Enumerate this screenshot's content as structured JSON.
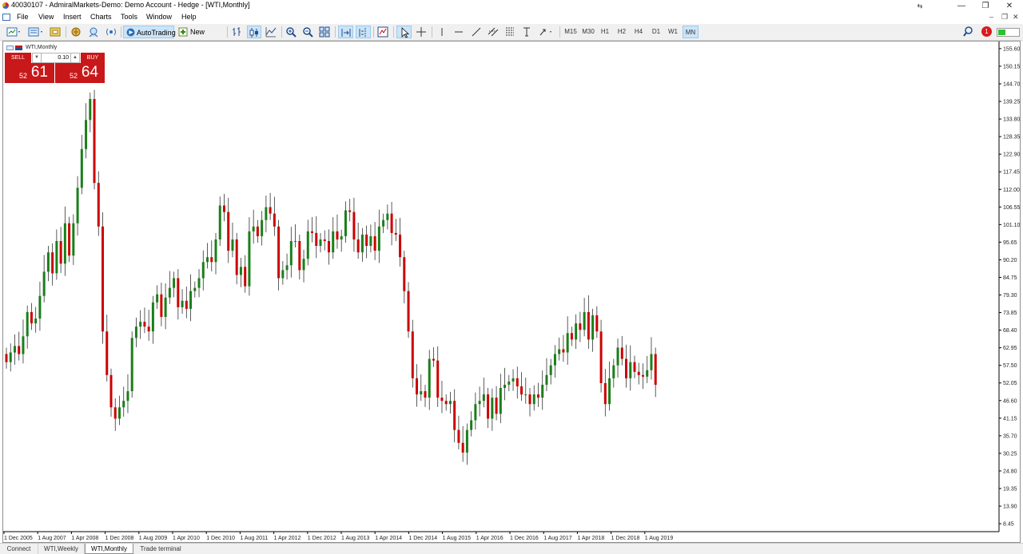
{
  "window": {
    "title": "40030107 - AdmiralMarkets-Demo: Demo Account - Hedge - [WTI,Monthly]",
    "controls": [
      "—",
      "❐",
      "✕"
    ]
  },
  "menu": [
    "File",
    "View",
    "Insert",
    "Charts",
    "Tools",
    "Window",
    "Help"
  ],
  "toolbar": {
    "autotrading": "AutoTrading",
    "new_order": "New Order",
    "notifications_count": "1"
  },
  "timeframes": [
    "M15",
    "M30",
    "H1",
    "H2",
    "H4",
    "D1",
    "W1",
    "MN"
  ],
  "active_timeframe": "MN",
  "chart": {
    "title": "WTI,Monthly",
    "trade_panel": {
      "sell_label": "SELL",
      "buy_label": "BUY",
      "lot": "0.10",
      "sell_prefix": "52",
      "sell_big": "61",
      "buy_prefix": "52",
      "buy_big": "64"
    },
    "colors": {
      "bull": "#1a7f1a",
      "bear": "#cc0000",
      "wick": "#333333",
      "grid": "#ffffff",
      "background": "#ffffff"
    }
  },
  "tabs": [
    "Connect",
    "WTI,Weekly",
    "WTI,Monthly",
    "Trade terminal"
  ],
  "active_tab": "WTI,Monthly",
  "chart_data": {
    "type": "candlestick",
    "symbol": "WTI",
    "timeframe": "Monthly",
    "x_labels": [
      "1 Dec 2005",
      "1 Aug 2007",
      "1 Apr 2008",
      "1 Dec 2008",
      "1 Aug 2009",
      "1 Apr 2010",
      "1 Dec 2010",
      "1 Aug 2011",
      "1 Apr 2012",
      "1 Dec 2012",
      "1 Aug 2013",
      "1 Apr 2014",
      "1 Dec 2014",
      "1 Aug 2015",
      "1 Apr 2016",
      "1 Dec 2016",
      "1 Aug 2017",
      "1 Apr 2018",
      "1 Dec 2018",
      "1 Aug 2019"
    ],
    "y_ticks": [
      "155.60",
      "150.15",
      "144.70",
      "139.25",
      "133.80",
      "128.35",
      "122.90",
      "117.45",
      "112.00",
      "106.55",
      "101.10",
      "95.65",
      "90.20",
      "84.75",
      "79.30",
      "73.85",
      "68.40",
      "62.95",
      "57.50",
      "52.05",
      "46.60",
      "41.15",
      "35.70",
      "30.25",
      "24.80",
      "19.35",
      "13.90",
      "8.45"
    ],
    "ylim": [
      6.0,
      157.8
    ],
    "closes": [
      58.5,
      61.5,
      63.5,
      61.0,
      66.5,
      74.0,
      70.5,
      72.0,
      79.0,
      86.5,
      92.5,
      86.0,
      96.0,
      89.0,
      101.5,
      91.5,
      101.5,
      112.5,
      124.5,
      133.5,
      140.0,
      114.0,
      100.5,
      68.0,
      54.5,
      44.5,
      41.0,
      44.5,
      46.5,
      49.5,
      66.0,
      69.5,
      71.0,
      69.5,
      68.0,
      77.0,
      79.5,
      72.5,
      78.5,
      81.5,
      84.5,
      75.5,
      77.5,
      75.0,
      80.5,
      81.5,
      84.5,
      89.5,
      91.0,
      89.5,
      96.5,
      107.0,
      105.0,
      93.0,
      96.5,
      85.5,
      88.0,
      82.0,
      99.0,
      100.5,
      97.5,
      102.5,
      106.5,
      104.5,
      100.5,
      84.5,
      87.0,
      88.5,
      96.0,
      96.0,
      87.0,
      90.5,
      99.0,
      98.5,
      94.5,
      96.5,
      96.0,
      92.5,
      99.0,
      96.5,
      97.5,
      105.5,
      105.0,
      96.5,
      92.5,
      98.0,
      94.5,
      97.5,
      93.0,
      100.5,
      102.5,
      104.5,
      98.5,
      98.0,
      91.0,
      80.5,
      68.0,
      53.5,
      48.5,
      49.5,
      47.5,
      59.5,
      59.0,
      47.5,
      46.5,
      45.5,
      46.5,
      37.5,
      33.5,
      30.5,
      37.5,
      40.5,
      45.5,
      46.5,
      48.5,
      41.0,
      47.5,
      42.5,
      50.5,
      51.5,
      52.5,
      53.5,
      51.0,
      48.5,
      48.5,
      45.5,
      48.5,
      47.5,
      51.5,
      54.5,
      57.5,
      61.0,
      62.5,
      61.5,
      67.5,
      65.5,
      70.5,
      68.5,
      74.0,
      65.5,
      73.0,
      68.0,
      52.0,
      45.5,
      53.5,
      57.5,
      63.0,
      59.5,
      53.5,
      58.5,
      55.5,
      54.5,
      54.0,
      56.0,
      61.0,
      51.5
    ],
    "opens": [
      61.0,
      58.5,
      61.5,
      63.5,
      61.0,
      66.5,
      74.0,
      70.5,
      72.0,
      79.0,
      86.5,
      92.5,
      86.0,
      96.0,
      89.0,
      101.5,
      91.5,
      101.5,
      112.5,
      124.5,
      133.5,
      140.0,
      114.0,
      100.5,
      68.0,
      54.5,
      44.5,
      41.0,
      44.5,
      46.5,
      49.5,
      66.0,
      69.5,
      71.0,
      69.5,
      68.0,
      77.0,
      79.5,
      72.5,
      78.5,
      81.5,
      84.5,
      75.5,
      77.5,
      75.0,
      80.5,
      81.5,
      84.5,
      89.5,
      91.0,
      89.5,
      96.5,
      107.0,
      105.0,
      93.0,
      96.5,
      85.5,
      88.0,
      82.0,
      99.0,
      100.5,
      97.5,
      102.5,
      106.5,
      104.5,
      100.5,
      84.5,
      87.0,
      88.5,
      96.0,
      96.0,
      87.0,
      90.5,
      99.0,
      98.5,
      94.5,
      96.5,
      96.0,
      92.5,
      99.0,
      96.5,
      97.5,
      105.5,
      105.0,
      96.5,
      92.5,
      98.0,
      94.5,
      97.5,
      93.0,
      100.5,
      102.5,
      104.5,
      98.5,
      98.0,
      91.0,
      80.5,
      68.0,
      53.5,
      48.5,
      49.5,
      47.5,
      59.5,
      59.0,
      47.5,
      46.5,
      45.5,
      46.5,
      37.5,
      33.5,
      30.5,
      37.5,
      40.5,
      45.5,
      46.5,
      48.5,
      41.0,
      47.5,
      42.5,
      50.5,
      51.5,
      52.5,
      53.5,
      51.0,
      48.5,
      48.5,
      45.5,
      48.5,
      47.5,
      51.5,
      54.5,
      57.5,
      61.0,
      62.5,
      61.5,
      67.5,
      65.5,
      70.5,
      68.5,
      74.0,
      65.5,
      73.0,
      68.0,
      52.0,
      45.5,
      53.5,
      57.5,
      63.0,
      59.5,
      53.5,
      58.5,
      55.5,
      54.5,
      54.0,
      56.0,
      61.0
    ]
  }
}
